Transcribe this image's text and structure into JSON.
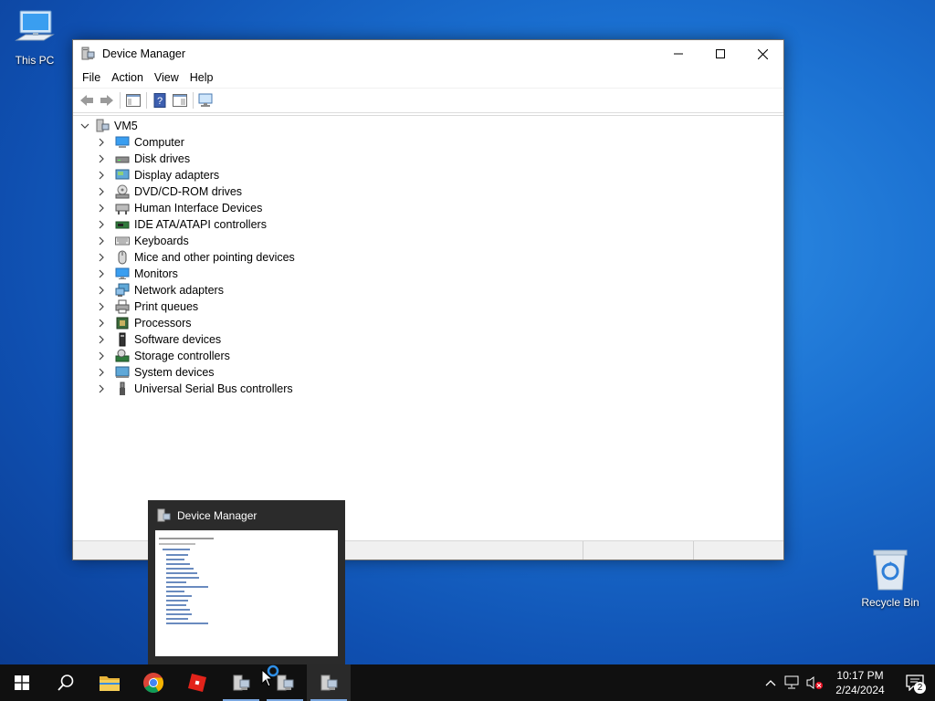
{
  "desktop": {
    "this_pc": "This PC",
    "recycle_bin": "Recycle Bin"
  },
  "window": {
    "title": "Device Manager",
    "menu": [
      "File",
      "Action",
      "View",
      "Help"
    ],
    "tree_root": "VM5",
    "tree_items": [
      {
        "label": "Computer",
        "icon": "computer-icon"
      },
      {
        "label": "Disk drives",
        "icon": "disk-drive-icon"
      },
      {
        "label": "Display adapters",
        "icon": "display-adapter-icon"
      },
      {
        "label": "DVD/CD-ROM drives",
        "icon": "dvd-drive-icon"
      },
      {
        "label": "Human Interface Devices",
        "icon": "hid-icon"
      },
      {
        "label": "IDE ATA/ATAPI controllers",
        "icon": "ide-controller-icon"
      },
      {
        "label": "Keyboards",
        "icon": "keyboard-icon"
      },
      {
        "label": "Mice and other pointing devices",
        "icon": "mouse-icon"
      },
      {
        "label": "Monitors",
        "icon": "monitor-icon"
      },
      {
        "label": "Network adapters",
        "icon": "network-adapter-icon"
      },
      {
        "label": "Print queues",
        "icon": "printer-icon"
      },
      {
        "label": "Processors",
        "icon": "processor-icon"
      },
      {
        "label": "Software devices",
        "icon": "software-device-icon"
      },
      {
        "label": "Storage controllers",
        "icon": "storage-controller-icon"
      },
      {
        "label": "System devices",
        "icon": "system-device-icon"
      },
      {
        "label": "Universal Serial Bus controllers",
        "icon": "usb-icon"
      }
    ]
  },
  "preview": {
    "title": "Device Manager"
  },
  "taskbar": {
    "clock_time": "10:17 PM",
    "clock_date": "2/24/2024",
    "notification_count": "2"
  }
}
